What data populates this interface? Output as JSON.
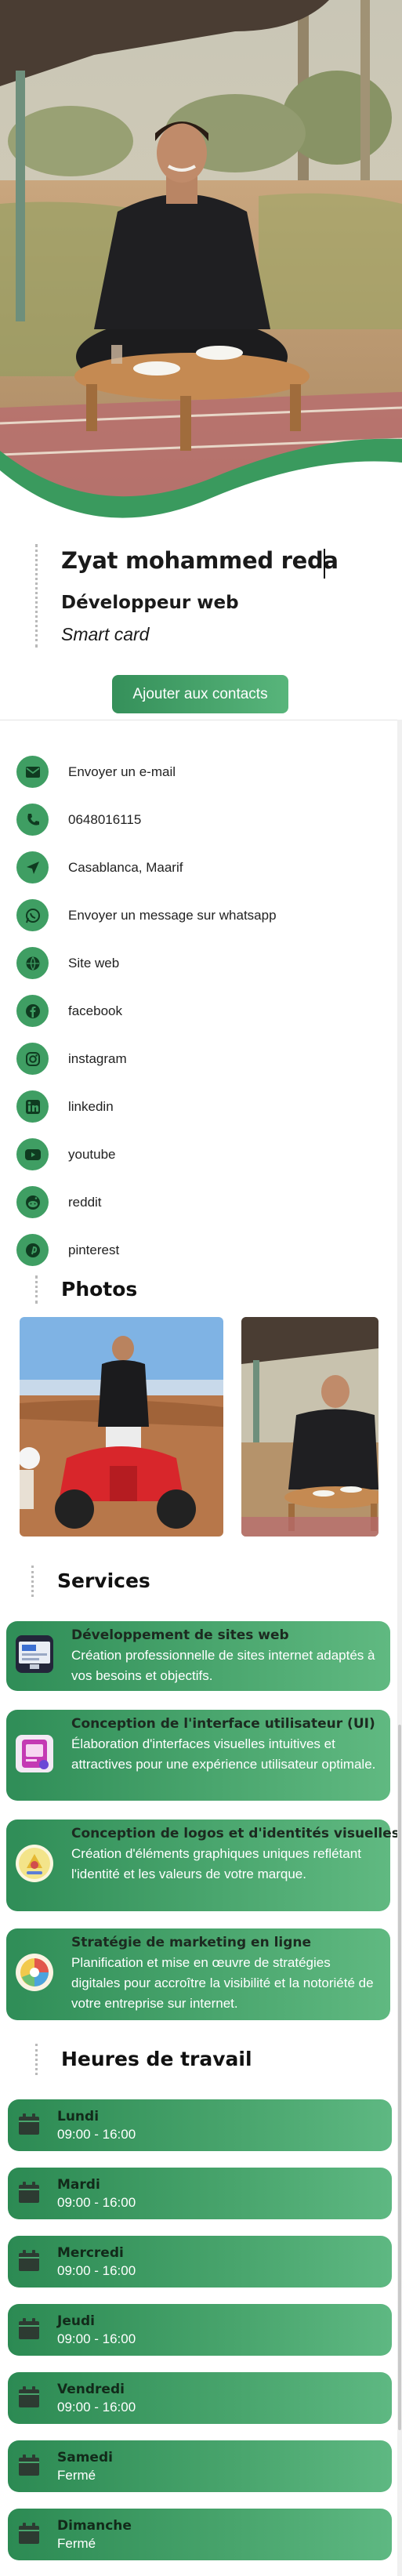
{
  "profile": {
    "name": "Zyat mohammed reda",
    "title": "Développeur web",
    "subtitle": "Smart card",
    "add_contact_label": "Ajouter aux contacts"
  },
  "colors": {
    "accent": "#3f9e63",
    "accent_dark": "#2c8a53",
    "accent_light": "#60b981"
  },
  "contacts": [
    {
      "icon": "envelope-icon",
      "label": "Envoyer un e-mail"
    },
    {
      "icon": "phone-icon",
      "label": "0648016115"
    },
    {
      "icon": "location-arrow-icon",
      "label": "Casablanca, Maarif"
    },
    {
      "icon": "whatsapp-icon",
      "label": "Envoyer un message sur whatsapp"
    },
    {
      "icon": "globe-icon",
      "label": "Site web"
    },
    {
      "icon": "facebook-icon",
      "label": "facebook"
    },
    {
      "icon": "instagram-icon",
      "label": "instagram"
    },
    {
      "icon": "linkedin-icon",
      "label": "linkedin"
    },
    {
      "icon": "youtube-icon",
      "label": "youtube"
    },
    {
      "icon": "reddit-icon",
      "label": "reddit"
    },
    {
      "icon": "pinterest-icon",
      "label": "pinterest"
    }
  ],
  "photos": {
    "heading": "Photos"
  },
  "services": {
    "heading": "Services",
    "items": [
      {
        "title": "Développement de sites web",
        "description": "Création professionnelle de sites internet adaptés à vos besoins et objectifs."
      },
      {
        "title": "Conception de l'interface utilisateur (UI)",
        "description": "Élaboration d'interfaces visuelles intuitives et attractives pour une expérience utilisateur optimale."
      },
      {
        "title": "Conception de logos et d'identités visuelles",
        "description": "Création d'éléments graphiques uniques reflétant l'identité et les valeurs de votre marque."
      },
      {
        "title": "Stratégie de marketing en ligne",
        "description": "Planification et mise en œuvre de stratégies digitales pour accroître la visibilité et la notoriété de votre entreprise sur internet."
      }
    ]
  },
  "hours": {
    "heading": "Heures de travail",
    "items": [
      {
        "day": "Lundi",
        "time": "09:00 - 16:00"
      },
      {
        "day": "Mardi",
        "time": "09:00 - 16:00"
      },
      {
        "day": "Mercredi",
        "time": "09:00 - 16:00"
      },
      {
        "day": "Jeudi",
        "time": "09:00 - 16:00"
      },
      {
        "day": "Vendredi",
        "time": "09:00 - 16:00"
      },
      {
        "day": "Samedi",
        "time": "Fermé"
      },
      {
        "day": "Dimanche",
        "time": "Fermé"
      }
    ]
  }
}
